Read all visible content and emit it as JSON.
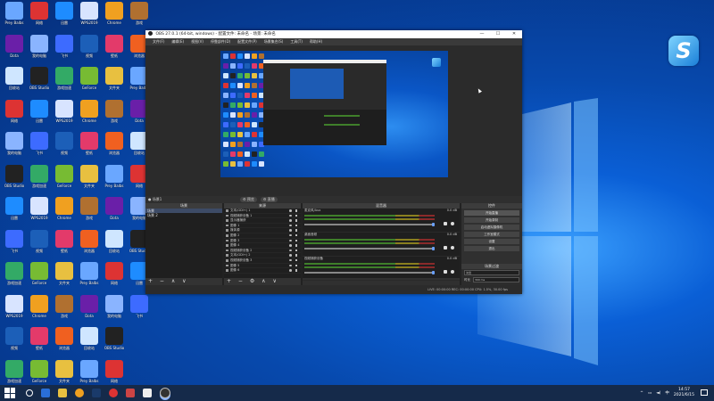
{
  "desktop": {
    "icons": [
      {
        "label": "Prey Balbs",
        "color": "#6aa7ff"
      },
      {
        "label": "网络",
        "color": "#d33"
      },
      {
        "label": "迅雷",
        "color": "#1e8cff"
      },
      {
        "label": "WPS2019",
        "color": "#d8e4ff"
      },
      {
        "label": "Chrome",
        "color": "#f0a020"
      },
      {
        "label": "游戏",
        "color": "#b07030"
      },
      {
        "label": "Dota",
        "color": "#6a1fa8"
      },
      {
        "label": "我的电脑",
        "color": "#8ab4ff"
      },
      {
        "label": "飞书",
        "color": "#3d6bff"
      },
      {
        "label": "视频",
        "color": "#1c5fb8"
      },
      {
        "label": "壁纸",
        "color": "#e33a6a"
      },
      {
        "label": "浏览器",
        "color": "#f06020"
      },
      {
        "label": "回收站",
        "color": "#cfe6ff"
      },
      {
        "label": "OBS Studio",
        "color": "#222"
      },
      {
        "label": "游戏加速",
        "color": "#3a6"
      },
      {
        "label": "GeForce",
        "color": "#7b3"
      },
      {
        "label": "文件夹",
        "color": "#e8c040"
      }
    ]
  },
  "obs": {
    "title": "OBS 27.0.1 (64-bit, windows) - 配置文件: 未命名 - 场景: 未命名",
    "window_controls": {
      "min": "—",
      "max": "☐",
      "close": "✕"
    },
    "menu": [
      "文件(F)",
      "编辑(E)",
      "视图(V)",
      "停靠部件(D)",
      "配置文件(P)",
      "场景集合(S)",
      "工具(T)",
      "帮助(H)"
    ],
    "scene_label": "● 场景1",
    "toggles": [
      "⚙ 预览",
      "⚙ 直播"
    ],
    "docks": {
      "scenes": {
        "title": "场景",
        "items": [
          "场景",
          "场景 2"
        ],
        "footer": "+ − ∧ ∨"
      },
      "sources": {
        "title": "来源",
        "items": [
          "文本(GDI+) 1",
          "视频捕获设备 1",
          "显示器捕获",
          "图像 1",
          "媒体源",
          "图像 2",
          "图像 3",
          "图像 4",
          "视频捕获设备 2",
          "文本(GDI+) 2",
          "视频捕获设备 3",
          "图像 5",
          "图像 6"
        ],
        "footer": "+ − ⚙ ∧ ∨"
      },
      "mixer": {
        "title": "混音器",
        "channels": [
          {
            "name": "麦克风/Aux",
            "level": "0.0 dB"
          },
          {
            "name": "桌面音频",
            "level": "0.0 dB"
          },
          {
            "name": "视频捕获设备",
            "level": "0.0 dB"
          }
        ]
      },
      "controls": {
        "title": "控件",
        "buttons": [
          "开始直播",
          "开始录制",
          "启动虚拟摄像机",
          "工作室模式",
          "设置",
          "退出"
        ]
      },
      "transitions": {
        "title": "场景过渡",
        "type_label": "淡出",
        "duration_label": "时长",
        "duration": "300 ms"
      }
    },
    "status": "LIVE: 00:00:00   REC: 00:00:00   CPU: 1.5%, 30.00 fps"
  },
  "taskbar": {
    "time": "14:57",
    "date": "2021/6/15",
    "lang": "中"
  }
}
